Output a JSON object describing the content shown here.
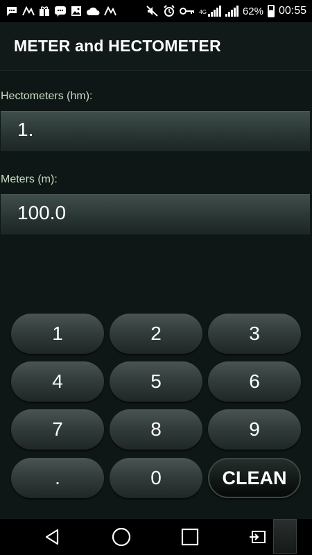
{
  "status_bar": {
    "battery": "62%",
    "time": "00:55",
    "network": "4G",
    "battery_level": 0.62
  },
  "title_bar": {
    "title": "METER and HECTOMETER"
  },
  "fields": {
    "hectometers": {
      "label": "Hectometers (hm):",
      "value": "1."
    },
    "meters": {
      "label": "Meters (m):",
      "value": "100.0"
    }
  },
  "keypad": {
    "keys": [
      "1",
      "2",
      "3",
      "4",
      "5",
      "6",
      "7",
      "8",
      "9",
      ".",
      "0",
      "CLEAN"
    ]
  },
  "colors": {
    "background": "#0f1816",
    "label": "#c7dcc4",
    "text": "#ffffff",
    "key_gradient_top": "#4a5553",
    "key_gradient_bottom": "#1e2725"
  },
  "nav_bar": {
    "icons": [
      "back-icon",
      "home-icon",
      "recents-icon",
      "screen-share-icon"
    ]
  }
}
